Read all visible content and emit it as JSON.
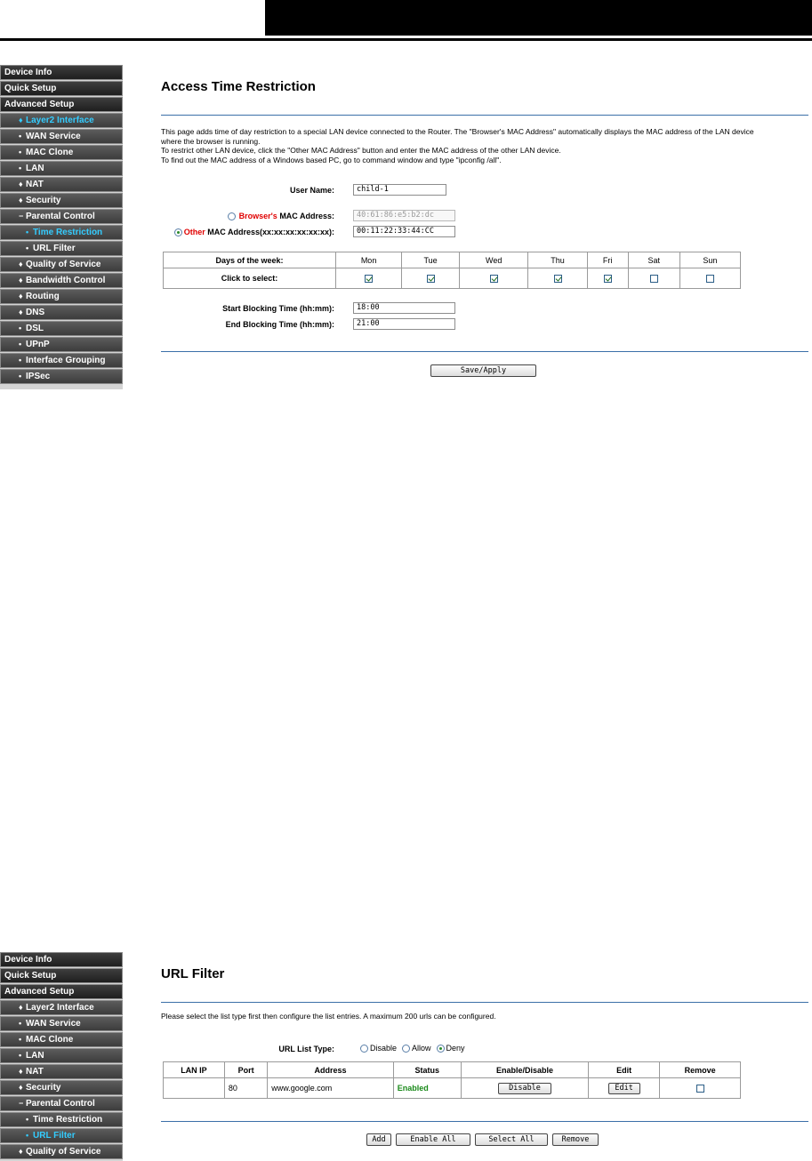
{
  "screen1": {
    "sidebar": [
      {
        "label": "Device Info",
        "level": "top",
        "active": false
      },
      {
        "label": "Quick Setup",
        "level": "top",
        "active": false
      },
      {
        "label": "Advanced Setup",
        "level": "top",
        "active": false
      },
      {
        "label": "Layer2 Interface",
        "level": "sub",
        "bullet": "♦",
        "active": true
      },
      {
        "label": "WAN Service",
        "level": "sub",
        "bullet": "•",
        "active": false
      },
      {
        "label": "MAC Clone",
        "level": "sub",
        "bullet": "•",
        "active": false
      },
      {
        "label": "LAN",
        "level": "sub",
        "bullet": "•",
        "active": false
      },
      {
        "label": "NAT",
        "level": "sub",
        "bullet": "♦",
        "active": false
      },
      {
        "label": "Security",
        "level": "sub",
        "bullet": "♦",
        "active": false
      },
      {
        "label": "Parental Control",
        "level": "sub",
        "bullet": "−",
        "active": false
      },
      {
        "label": "Time Restriction",
        "level": "sub2",
        "bullet": "•",
        "active": true
      },
      {
        "label": "URL Filter",
        "level": "sub2",
        "bullet": "•",
        "active": false
      },
      {
        "label": "Quality of Service",
        "level": "sub",
        "bullet": "♦",
        "active": false
      },
      {
        "label": "Bandwidth Control",
        "level": "sub",
        "bullet": "♦",
        "active": false
      },
      {
        "label": "Routing",
        "level": "sub",
        "bullet": "♦",
        "active": false
      },
      {
        "label": "DNS",
        "level": "sub",
        "bullet": "♦",
        "active": false
      },
      {
        "label": "DSL",
        "level": "sub",
        "bullet": "•",
        "active": false
      },
      {
        "label": "UPnP",
        "level": "sub",
        "bullet": "•",
        "active": false
      },
      {
        "label": "Interface Grouping",
        "level": "sub",
        "bullet": "•",
        "active": false
      },
      {
        "label": "IPSec",
        "level": "sub",
        "bullet": "•",
        "active": false
      }
    ],
    "title": "Access Time Restriction",
    "desc": [
      "This page adds time of day restriction to a special LAN device connected to the Router. The \"Browser's MAC Address\" automatically displays the MAC address of the LAN device",
      "where the browser is running.",
      "To restrict other LAN device, click the \"Other MAC Address\" button and enter the MAC address of the other LAN device.",
      "To find out the MAC address of a Windows based PC, go to command window and type \"ipconfig /all\"."
    ],
    "user_name_label": "User Name:",
    "user_name_value": "child-1",
    "browser_mac_red": "Browser's",
    "browser_mac_rest": " MAC Address:",
    "browser_mac_value": "40:61:86:e5:b2:dc",
    "other_mac_red": "Other",
    "other_mac_rest": " MAC Address(xx:xx:xx:xx:xx:xx):",
    "other_mac_value": "00:11:22:33:44:CC",
    "days_label": "Days of the week:",
    "click_label": "Click to select:",
    "days": [
      {
        "name": "Mon",
        "checked": true
      },
      {
        "name": "Tue",
        "checked": true
      },
      {
        "name": "Wed",
        "checked": true
      },
      {
        "name": "Thu",
        "checked": true
      },
      {
        "name": "Fri",
        "checked": true
      },
      {
        "name": "Sat",
        "checked": false
      },
      {
        "name": "Sun",
        "checked": false
      }
    ],
    "start_label": "Start Blocking Time (hh:mm):",
    "start_value": "18:00",
    "end_label": "End Blocking Time (hh:mm):",
    "end_value": "21:00",
    "save_label": "Save/Apply"
  },
  "screen2": {
    "sidebar": [
      {
        "label": "Device Info",
        "level": "top",
        "active": false
      },
      {
        "label": "Quick Setup",
        "level": "top",
        "active": false
      },
      {
        "label": "Advanced Setup",
        "level": "top",
        "active": false
      },
      {
        "label": "Layer2 Interface",
        "level": "sub",
        "bullet": "♦",
        "active": false
      },
      {
        "label": "WAN Service",
        "level": "sub",
        "bullet": "•",
        "active": false
      },
      {
        "label": "MAC Clone",
        "level": "sub",
        "bullet": "•",
        "active": false
      },
      {
        "label": "LAN",
        "level": "sub",
        "bullet": "•",
        "active": false
      },
      {
        "label": "NAT",
        "level": "sub",
        "bullet": "♦",
        "active": false
      },
      {
        "label": "Security",
        "level": "sub",
        "bullet": "♦",
        "active": false
      },
      {
        "label": "Parental Control",
        "level": "sub",
        "bullet": "−",
        "active": false
      },
      {
        "label": "Time Restriction",
        "level": "sub2",
        "bullet": "•",
        "active": false
      },
      {
        "label": "URL Filter",
        "level": "sub2",
        "bullet": "•",
        "active": true
      },
      {
        "label": "Quality of Service",
        "level": "sub",
        "bullet": "♦",
        "active": false
      }
    ],
    "title": "URL Filter",
    "desc": "Please select the list type first then configure the list entries. A maximum 200 urls can be configured.",
    "list_type_label": "URL List Type:",
    "list_types": [
      {
        "label": "Disable",
        "selected": false
      },
      {
        "label": "Allow",
        "selected": false
      },
      {
        "label": "Deny",
        "selected": true
      }
    ],
    "columns": [
      "LAN IP",
      "Port",
      "Address",
      "Status",
      "Enable/Disable",
      "Edit",
      "Remove"
    ],
    "rows": [
      {
        "lan_ip": "",
        "port": "80",
        "address": "www.google.com",
        "status": "Enabled",
        "toggle": "Disable",
        "edit": "Edit"
      }
    ],
    "buttons": {
      "add": "Add",
      "enable_all": "Enable All",
      "select_all": "Select All",
      "remove": "Remove"
    }
  }
}
